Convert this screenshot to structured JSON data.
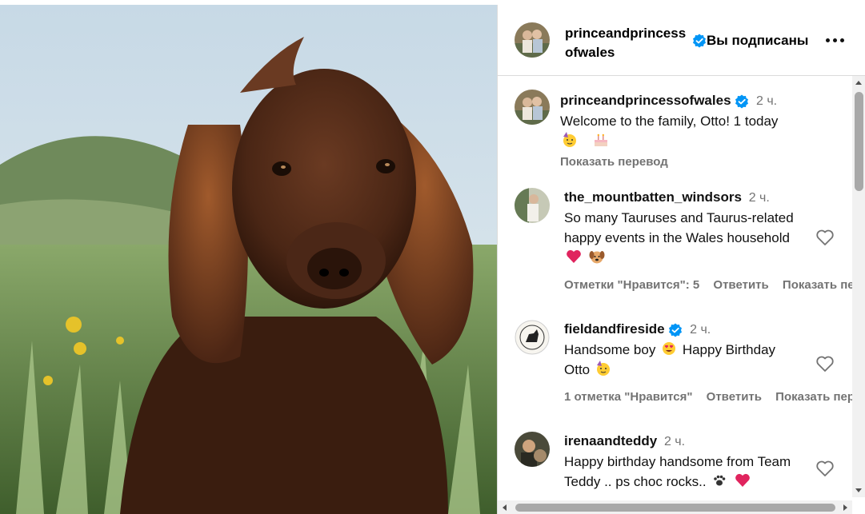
{
  "post": {
    "image": {
      "subject": "brown cocker spaniel dog",
      "colors": {
        "sky": "#d5e3ec",
        "grass": "#6a8c4a",
        "fur": "#5a3220",
        "flowers": "#e5c22a"
      }
    }
  },
  "header": {
    "username": "princeandprincessofwales",
    "verified": true,
    "follow_status": "Вы подписаны",
    "more_icon": "more-horizontal-icon"
  },
  "caption": {
    "username": "princeandprincessofwales",
    "verified": true,
    "time": "2 ч.",
    "text": "Welcome to the family, Otto! 1 today",
    "emojis": [
      "partying-face-emoji",
      "birthday-cake-emoji"
    ],
    "translate_label": "Показать перевод"
  },
  "comments": [
    {
      "username": "the_mountbatten_windsors",
      "verified": false,
      "time": "2 ч.",
      "text": "So many Tauruses and Taurus-related happy events in the Wales household",
      "emojis": [
        "red-heart-emoji",
        "dog-face-emoji"
      ],
      "likes_label": "Отметки \"Нравится\": 5",
      "reply_label": "Ответить",
      "translate_label": "Показать перевод"
    },
    {
      "username": "fieldandfireside",
      "verified": true,
      "time": "2 ч.",
      "text_parts": [
        "Handsome boy",
        "Happy Birthday Otto"
      ],
      "emojis": [
        "smiling-face-with-heart-eyes-emoji",
        "partying-face-emoji"
      ],
      "likes_label": "1 отметка \"Нравится\"",
      "reply_label": "Ответить",
      "translate_label": "Показать перевод"
    },
    {
      "username": "irenaandteddy",
      "verified": false,
      "time": "2 ч.",
      "text": "Happy birthday handsome from Team Teddy .. ps choc rocks..",
      "emojis": [
        "paw-prints-emoji",
        "red-heart-emoji"
      ]
    }
  ],
  "colors": {
    "verified_blue": "#0095f6",
    "meta_grey": "#737373",
    "heart_red": "#e0245e",
    "border": "#dbdbdb"
  }
}
